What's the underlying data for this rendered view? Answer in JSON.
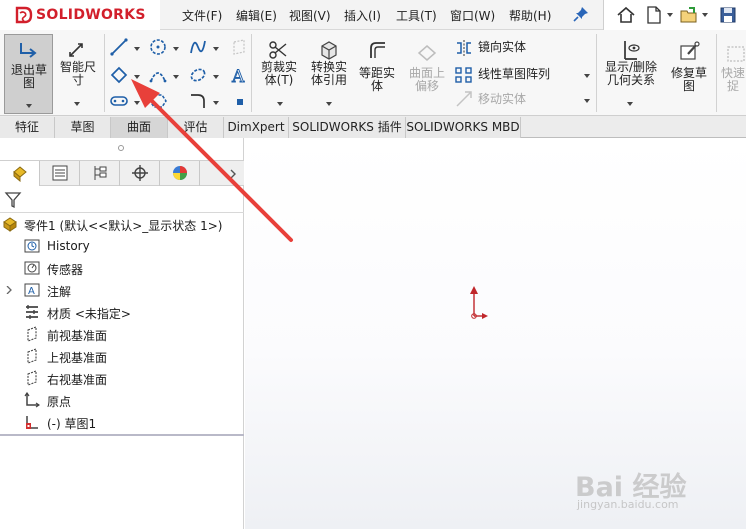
{
  "app": {
    "brand": "SOLIDWORKS"
  },
  "menu": {
    "items": [
      "文件(F)",
      "编辑(E)",
      "视图(V)",
      "插入(I)",
      "工具(T)",
      "窗口(W)",
      "帮助(H)"
    ]
  },
  "ribbon": {
    "exit_sketch": "退出草\n图",
    "smart_dim": "智能尺\n寸",
    "trim": "剪裁实\n体(T)",
    "convert": "转换实\n体引用",
    "offset": "等距实\n体",
    "surface_offset": "曲面上\n偏移",
    "mirror": "镜向实体",
    "linear_pattern": "线性草图阵列",
    "move": "移动实体",
    "display_relations": "显示/删除\n几何关系",
    "repair": "修复草\n图",
    "rapid": "快速\n捉"
  },
  "tabs": [
    "特征",
    "草图",
    "曲面",
    "评估",
    "DimXpert",
    "SOLIDWORKS 插件",
    "SOLIDWORKS MBD"
  ],
  "active_tab": "曲面",
  "tree": {
    "root": "零件1  (默认<<默认>_显示状态 1>)",
    "items": [
      {
        "label": "History",
        "icon": "history-icon"
      },
      {
        "label": "传感器",
        "icon": "sensor-icon"
      },
      {
        "label": "注解",
        "icon": "annotation-icon"
      },
      {
        "label": "材质 <未指定>",
        "icon": "material-icon"
      },
      {
        "label": "前视基准面",
        "icon": "plane-icon"
      },
      {
        "label": "上视基准面",
        "icon": "plane-icon"
      },
      {
        "label": "右视基准面",
        "icon": "plane-icon"
      },
      {
        "label": "原点",
        "icon": "origin-icon"
      },
      {
        "label": "(-) 草图1",
        "icon": "sketch-icon"
      }
    ]
  },
  "watermark": {
    "main": "Bai 经验",
    "sub": "jingyan.baidu.com"
  },
  "colors": {
    "brand_red": "#d21f2b",
    "annotation_red": "#e8403a",
    "icon_blue": "#1f5fa8"
  }
}
